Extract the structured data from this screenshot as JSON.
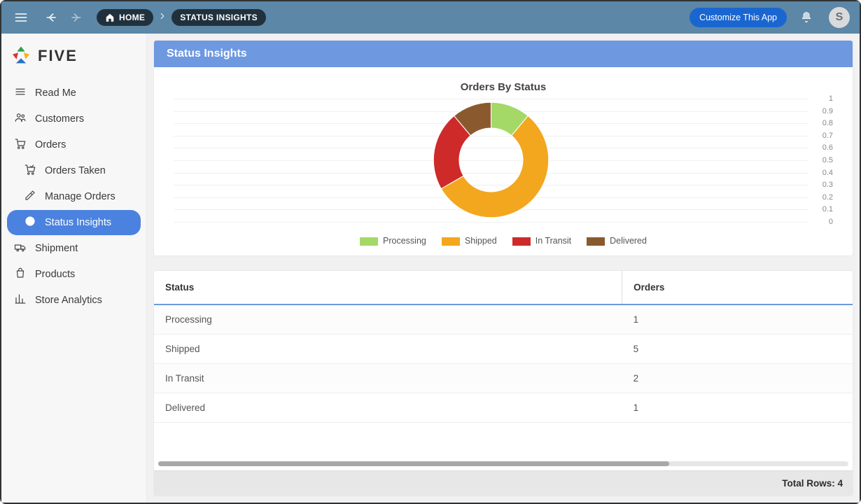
{
  "topbar": {
    "home_label": "HOME",
    "crumb_label": "STATUS INSIGHTS",
    "customize_label": "Customize This App",
    "avatar_initial": "S"
  },
  "brand": {
    "name": "FIVE"
  },
  "sidebar": {
    "items": [
      {
        "label": "Read Me",
        "icon": "readme-icon",
        "child": false,
        "active": false
      },
      {
        "label": "Customers",
        "icon": "customers-icon",
        "child": false,
        "active": false
      },
      {
        "label": "Orders",
        "icon": "orders-icon",
        "child": false,
        "active": false
      },
      {
        "label": "Orders Taken",
        "icon": "orders-taken-icon",
        "child": true,
        "active": false
      },
      {
        "label": "Manage Orders",
        "icon": "edit-icon",
        "child": true,
        "active": false
      },
      {
        "label": "Status Insights",
        "icon": "target-icon",
        "child": true,
        "active": true
      },
      {
        "label": "Shipment",
        "icon": "truck-icon",
        "child": false,
        "active": false
      },
      {
        "label": "Products",
        "icon": "bag-icon",
        "child": false,
        "active": false
      },
      {
        "label": "Store Analytics",
        "icon": "analytics-icon",
        "child": false,
        "active": false
      }
    ]
  },
  "panel": {
    "title": "Status Insights"
  },
  "chart_data": {
    "type": "pie",
    "title": "Orders By Status",
    "series": [
      {
        "name": "Processing",
        "value": 1,
        "color": "#a4d968"
      },
      {
        "name": "Shipped",
        "value": 5,
        "color": "#f3a71e"
      },
      {
        "name": "In Transit",
        "value": 2,
        "color": "#cf2a2a"
      },
      {
        "name": "Delivered",
        "value": 1,
        "color": "#8a5a2e"
      }
    ],
    "y_ticks": [
      "1",
      "0.9",
      "0.8",
      "0.7",
      "0.6",
      "0.5",
      "0.4",
      "0.3",
      "0.2",
      "0.1",
      "0"
    ]
  },
  "table": {
    "columns": [
      "Status",
      "Orders"
    ],
    "rows": [
      {
        "status": "Processing",
        "orders": "1"
      },
      {
        "status": "Shipped",
        "orders": "5"
      },
      {
        "status": "In Transit",
        "orders": "2"
      },
      {
        "status": "Delivered",
        "orders": "1"
      }
    ],
    "footer_label": "Total Rows: 4"
  }
}
